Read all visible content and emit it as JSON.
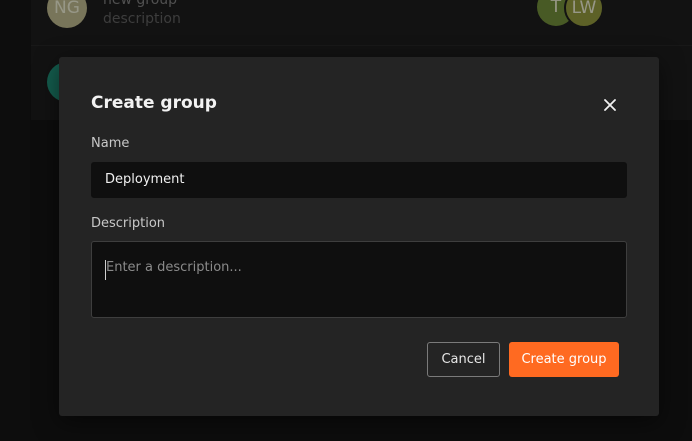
{
  "background": {
    "rows": [
      {
        "avatar_initials": "NG",
        "title": "new group",
        "description": "description",
        "members": [
          "T",
          "LW"
        ]
      },
      {
        "avatar_initials": ""
      }
    ]
  },
  "modal": {
    "title": "Create group",
    "close_icon": "close-icon",
    "name_label": "Name",
    "name_value": "Deployment",
    "description_label": "Description",
    "description_placeholder": "Enter a description...",
    "description_value": "",
    "cancel_label": "Cancel",
    "create_label": "Create group"
  },
  "colors": {
    "accent": "#ff6a21",
    "modal_bg": "#242424",
    "input_bg": "#0f0f0f",
    "page_bg": "#141414"
  }
}
